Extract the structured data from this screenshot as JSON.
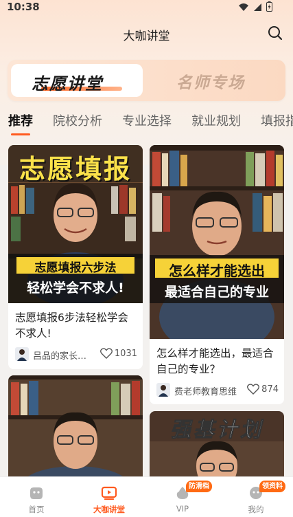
{
  "status_bar": {
    "time": "10:38"
  },
  "header": {
    "title": "大咖讲堂"
  },
  "segment": {
    "active": "志愿讲堂",
    "inactive": "名师专场"
  },
  "tabs": [
    {
      "label": "推荐"
    },
    {
      "label": "院校分析"
    },
    {
      "label": "专业选择"
    },
    {
      "label": "就业规划"
    },
    {
      "label": "填报指"
    }
  ],
  "cards": [
    {
      "cover_top": "志愿填报",
      "cover_line1": "志愿填报六步法",
      "cover_line2": "轻松学会不求人!",
      "title": "志愿填报6步法轻松学会不求人!",
      "author": "吕品的家长…",
      "likes": "1031"
    },
    {
      "cover_line1": "怎么样才能选出",
      "cover_line2": "最适合自己的专业",
      "title": "怎么样才能选出，最适合自己的专业？",
      "author": "费老师教育思维",
      "likes": "874"
    },
    {
      "cover_top": ""
    },
    {
      "cover_top": "强基计划"
    }
  ],
  "tabbar": {
    "items": [
      {
        "label": "首页",
        "icon": "home-icon"
      },
      {
        "label": "大咖讲堂",
        "icon": "video-play-icon"
      },
      {
        "label": "VIP",
        "icon": "vip-icon",
        "badge": "防滑档"
      },
      {
        "label": "我的",
        "icon": "profile-icon",
        "badge": "领资料"
      }
    ]
  },
  "colors": {
    "accent": "#ff5a1f",
    "badge": "#ff6a14"
  }
}
